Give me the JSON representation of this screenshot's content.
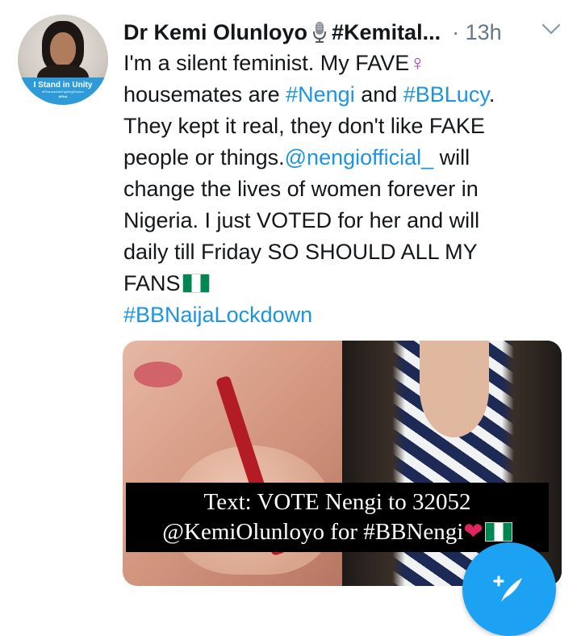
{
  "tweet": {
    "author": {
      "display_name": "Dr Kemi Olunloyo",
      "name_emoji_icon": "microphone-icon",
      "name_suffix": "#Kemital...",
      "avatar_banner_title": "I Stand in Unity",
      "avatar_banner_subtitle": "#PharmacistsFightingRacism",
      "avatar_banner_logo": "APhA"
    },
    "time": "· 13h",
    "body": {
      "line1_a": "I'm a silent feminist. My FAVE",
      "line1_symbol": "♀",
      "line2_a": "housemates are ",
      "line2_tag1": "#Nengi",
      "line2_b": " and ",
      "line2_tag2": "#BBLucy",
      "line2_c": ".",
      "line3": "They kept it real, they don't like FAKE",
      "line4_a": "people or things.",
      "line4_mention": "@nengiofficial_",
      "line4_b": " will",
      "line5": "change the lives of women forever in",
      "line6": "Nigeria. I just VOTED for her and will",
      "line7": "daily till Friday SO SHOULD ALL MY",
      "line8": "FANS",
      "line8_icon": "nigeria-flag-icon",
      "hashtag": "#BBNaijaLockdown"
    },
    "media": {
      "caption_line1": "Text: VOTE Nengi to 32052",
      "caption_line2": "@KemiOlunloyo for #BBNengi",
      "caption_heart": "❤"
    }
  },
  "compose_button_icon": "compose-tweet-icon",
  "colors": {
    "link": "#1b95e0",
    "text": "#14171a",
    "muted": "#657786",
    "accent": "#1da1f2"
  }
}
